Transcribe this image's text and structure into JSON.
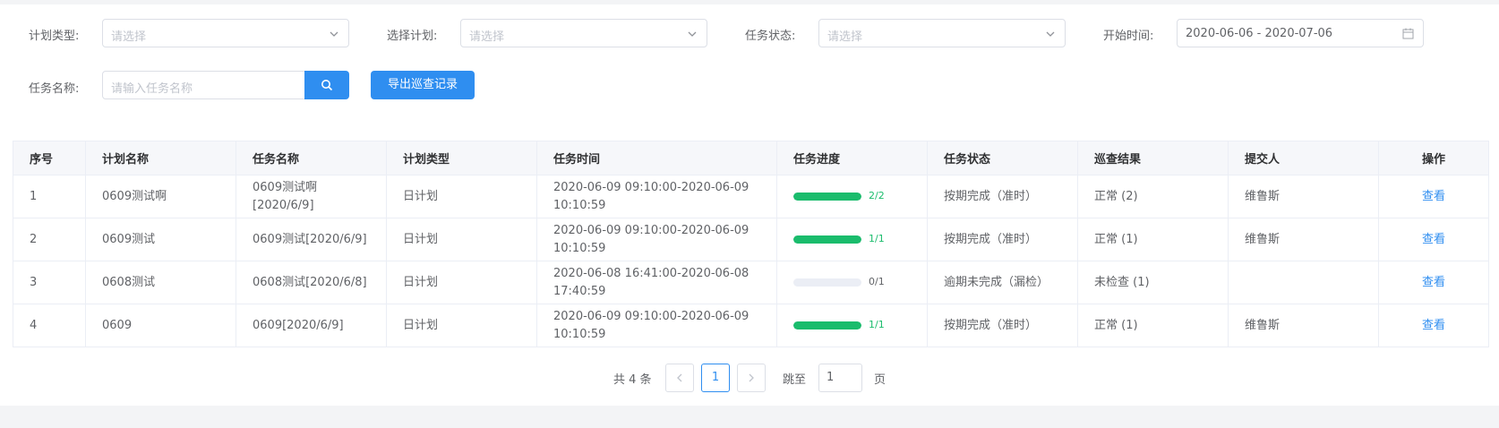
{
  "filters": {
    "plan_type": {
      "label": "计划类型:",
      "placeholder": "请选择"
    },
    "plan": {
      "label": "选择计划:",
      "placeholder": "请选择"
    },
    "task_status": {
      "label": "任务状态:",
      "placeholder": "请选择"
    },
    "start_time": {
      "label": "开始时间:",
      "value": "2020-06-06 - 2020-07-06"
    },
    "task_name": {
      "label": "任务名称:",
      "placeholder": "请输入任务名称"
    },
    "export_label": "导出巡查记录"
  },
  "table": {
    "headers": [
      "序号",
      "计划名称",
      "任务名称",
      "计划类型",
      "任务时间",
      "任务进度",
      "任务状态",
      "巡查结果",
      "提交人",
      "操作"
    ],
    "rows": [
      {
        "no": "1",
        "plan": "0609测试啊",
        "task": "0609测试啊[2020/6/9]",
        "type": "日计划",
        "time": "2020-06-09 09:10:00-2020-06-09 10:10:59",
        "progress_text": "2/2",
        "progress": 1.0,
        "status": "按期完成（准时）",
        "result": "正常 (2)",
        "submitter": "维鲁斯",
        "action": "查看"
      },
      {
        "no": "2",
        "plan": "0609测试",
        "task": "0609测试[2020/6/9]",
        "type": "日计划",
        "time": "2020-06-09 09:10:00-2020-06-09 10:10:59",
        "progress_text": "1/1",
        "progress": 1.0,
        "status": "按期完成（准时）",
        "result": "正常 (1)",
        "submitter": "维鲁斯",
        "action": "查看"
      },
      {
        "no": "3",
        "plan": "0608测试",
        "task": "0608测试[2020/6/8]",
        "type": "日计划",
        "time": "2020-06-08 16:41:00-2020-06-08 17:40:59",
        "progress_text": "0/1",
        "progress": 0.0,
        "status": "逾期未完成（漏检）",
        "result": "未检查 (1)",
        "submitter": "",
        "action": "查看"
      },
      {
        "no": "4",
        "plan": "0609",
        "task": "0609[2020/6/9]",
        "type": "日计划",
        "time": "2020-06-09 09:10:00-2020-06-09 10:10:59",
        "progress_text": "1/1",
        "progress": 1.0,
        "status": "按期完成（准时）",
        "result": "正常 (1)",
        "submitter": "维鲁斯",
        "action": "查看"
      }
    ]
  },
  "pagination": {
    "total_label": "共 4 条",
    "current_page": "1",
    "jump_label": "跳至",
    "jump_value": "1",
    "page_label": "页",
    "prev_icon": "chevron-left-icon",
    "next_icon": "chevron-right-icon"
  },
  "colors": {
    "primary": "#2f8ef0",
    "progress": "#1abc6c"
  }
}
